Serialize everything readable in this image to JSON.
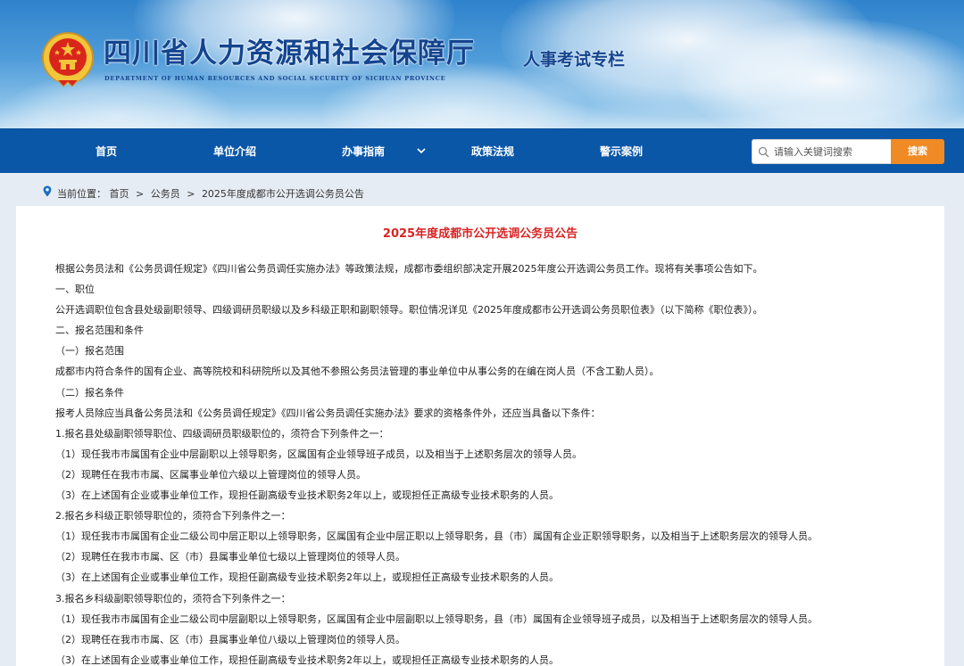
{
  "header": {
    "title_cn": "四川省人力资源和社会保障厅",
    "title_en": "DEPARTMENT OF HUMAN RESOURCES AND SOCIAL SECURITY OF SICHUAN PROVINCE",
    "column_tag": "人事考试专栏",
    "emblem_icon": "national-emblem-icon"
  },
  "nav": {
    "items": [
      {
        "label": "首页"
      },
      {
        "label": "单位介绍"
      },
      {
        "label": "办事指南",
        "has_dropdown": true
      },
      {
        "label": "政策法规"
      },
      {
        "label": "警示案例"
      }
    ],
    "search_placeholder": "请输入关键词搜索",
    "search_button": "搜索"
  },
  "breadcrumb": {
    "prefix": "当前位置：",
    "items": [
      "首页",
      "公务员",
      "2025年度成都市公开选调公务员公告"
    ],
    "separator": ">"
  },
  "article": {
    "title": "2025年度成都市公开选调公务员公告",
    "paragraphs": [
      "根据公务员法和《公务员调任规定》《四川省公务员调任实施办法》等政策法规，成都市委组织部决定开展2025年度公开选调公务员工作。现将有关事项公告如下。",
      "一、职位",
      "公开选调职位包含县处级副职领导、四级调研员职级以及乡科级正职和副职领导。职位情况详见《2025年度成都市公开选调公务员职位表》（以下简称《职位表》）。",
      "二、报名范围和条件",
      "（一）报名范围",
      "成都市内符合条件的国有企业、高等院校和科研院所以及其他不参照公务员法管理的事业单位中从事公务的在编在岗人员（不含工勤人员）。",
      "（二）报名条件",
      "报考人员除应当具备公务员法和《公务员调任规定》《四川省公务员调任实施办法》要求的资格条件外，还应当具备以下条件：",
      "1.报名县处级副职领导职位、四级调研员职级职位的，须符合下列条件之一：",
      "（1）现任我市市属国有企业中层副职以上领导职务，区属国有企业领导班子成员，以及相当于上述职务层次的领导人员。",
      "（2）现聘任在我市市属、区属事业单位六级以上管理岗位的领导人员。",
      "（3）在上述国有企业或事业单位工作，现担任副高级专业技术职务2年以上，或现担任正高级专业技术职务的人员。",
      "2.报名乡科级正职领导职位的，须符合下列条件之一：",
      "（1）现任我市市属国有企业二级公司中层正职以上领导职务，区属国有企业中层正职以上领导职务，县（市）属国有企业正职领导职务，以及相当于上述职务层次的领导人员。",
      "（2）现聘任在我市市属、区（市）县属事业单位七级以上管理岗位的领导人员。",
      "（3）在上述国有企业或事业单位工作，现担任副高级专业技术职务2年以上，或现担任正高级专业技术职务的人员。",
      "3.报名乡科级副职领导职位的，须符合下列条件之一：",
      "（1）现任我市市属国有企业二级公司中层副职以上领导职务，区属国有企业中层副职以上领导职务，县（市）属国有企业领导班子成员，以及相当于上述职务层次的领导人员。",
      "（2）现聘任在我市市属、区（市）县属事业单位八级以上管理岗位的领导人员。",
      "（3）在上述国有企业或事业单位工作，现担任副高级专业技术职务2年以上，或现担任正高级专业技术职务的人员。"
    ]
  },
  "colors": {
    "nav_bg": "#0a57a8",
    "title_red": "#d92424",
    "search_orange": "#f08a24",
    "brand_blue": "#14448f",
    "page_bg": "#e6ecf3"
  }
}
